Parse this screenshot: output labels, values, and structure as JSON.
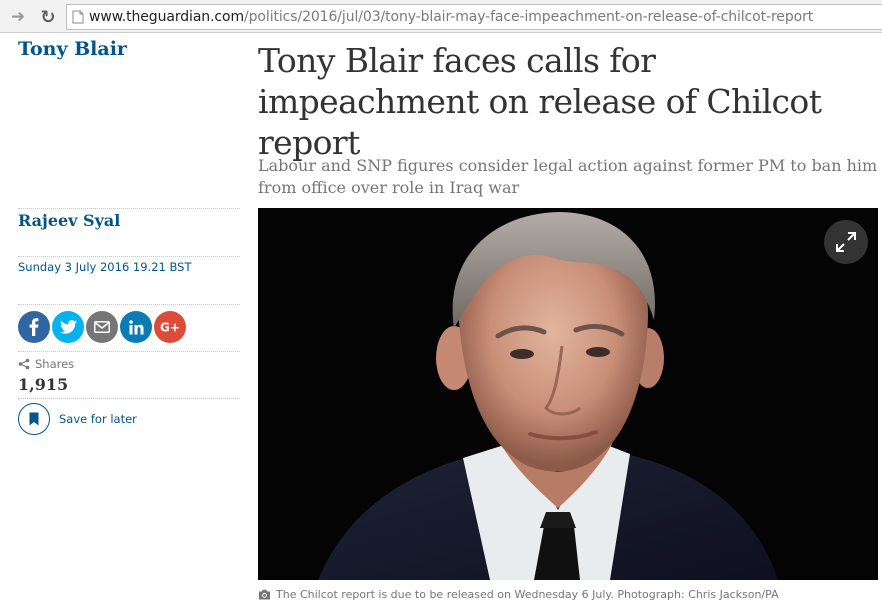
{
  "browser": {
    "url_host": "www.theguardian.com",
    "url_path": "/politics/2016/jul/03/tony-blair-may-face-impeachment-on-release-of-chilcot-report",
    "icons": [
      "forward-arrow-icon",
      "reload-icon",
      "page-icon"
    ]
  },
  "article": {
    "section": "Tony Blair",
    "headline": "Tony Blair faces calls for impeachment on release of Chilcot report",
    "standfirst": "Labour and SNP figures consider legal action against former PM to ban him from office over role in Iraq war",
    "author": "Rajeev Syal",
    "date": "Sunday 3 July 2016 19.21 BST",
    "share": {
      "buttons": [
        {
          "name": "facebook",
          "icon": "facebook-icon",
          "color": "#3067a3"
        },
        {
          "name": "twitter",
          "icon": "twitter-icon",
          "color": "#03b3ee"
        },
        {
          "name": "email",
          "icon": "email-icon",
          "color": "#767676"
        },
        {
          "name": "linkedin",
          "icon": "linkedin-icon",
          "color": "#0b7bb5"
        },
        {
          "name": "googleplus",
          "icon": "google-plus-icon",
          "color": "#dd4b39"
        }
      ],
      "shares_label": "Shares",
      "shares_count": "1,915"
    },
    "save_label": "Save for later",
    "caption": "The Chilcot report is due to be released on Wednesday 6 July. Photograph: Chris Jackson/PA"
  },
  "colors": {
    "guardian_blue": "#005689",
    "text": "#333333",
    "muted": "#767676"
  }
}
